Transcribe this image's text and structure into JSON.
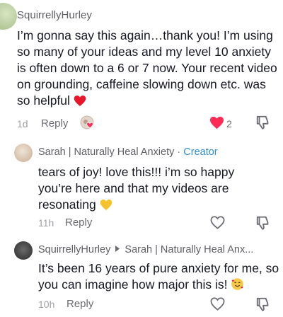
{
  "comments": [
    {
      "username": "SquirrellyHurley",
      "text": "I’m gonna say this again…thank you! I’m using so many of your ideas and my level 10 anxiety is often down to a 6 or 7 now. Your recent video on grounding, caffeine slowing down etc. was so helpful",
      "time": "1d",
      "reply_label": "Reply",
      "like_count": "2",
      "liked": true
    },
    {
      "username": "Sarah | Naturally Heal Anxiety",
      "separator": "·",
      "badge": "Creator",
      "text": "tears of joy! love this!!! i’m so happy you’re here and that my videos are resonating",
      "time": "11h",
      "reply_label": "Reply"
    },
    {
      "username": "SquirrellyHurley",
      "reply_to": "Sarah | Naturally Heal Anx...",
      "text": "It’s been 16 years of pure anxiety for me, so you can imagine how major this is!",
      "time": "10h",
      "reply_label": "Reply"
    }
  ],
  "colors": {
    "like_red": "#fe2c55",
    "creator_blue": "#2f8fd0"
  },
  "icons": [
    "heart-icon",
    "thumbs-down-icon",
    "creator-like-avatar-icon",
    "yellow-heart-emoji",
    "red-heart-emoji",
    "smiling-hearts-emoji",
    "reply-arrow-icon"
  ]
}
